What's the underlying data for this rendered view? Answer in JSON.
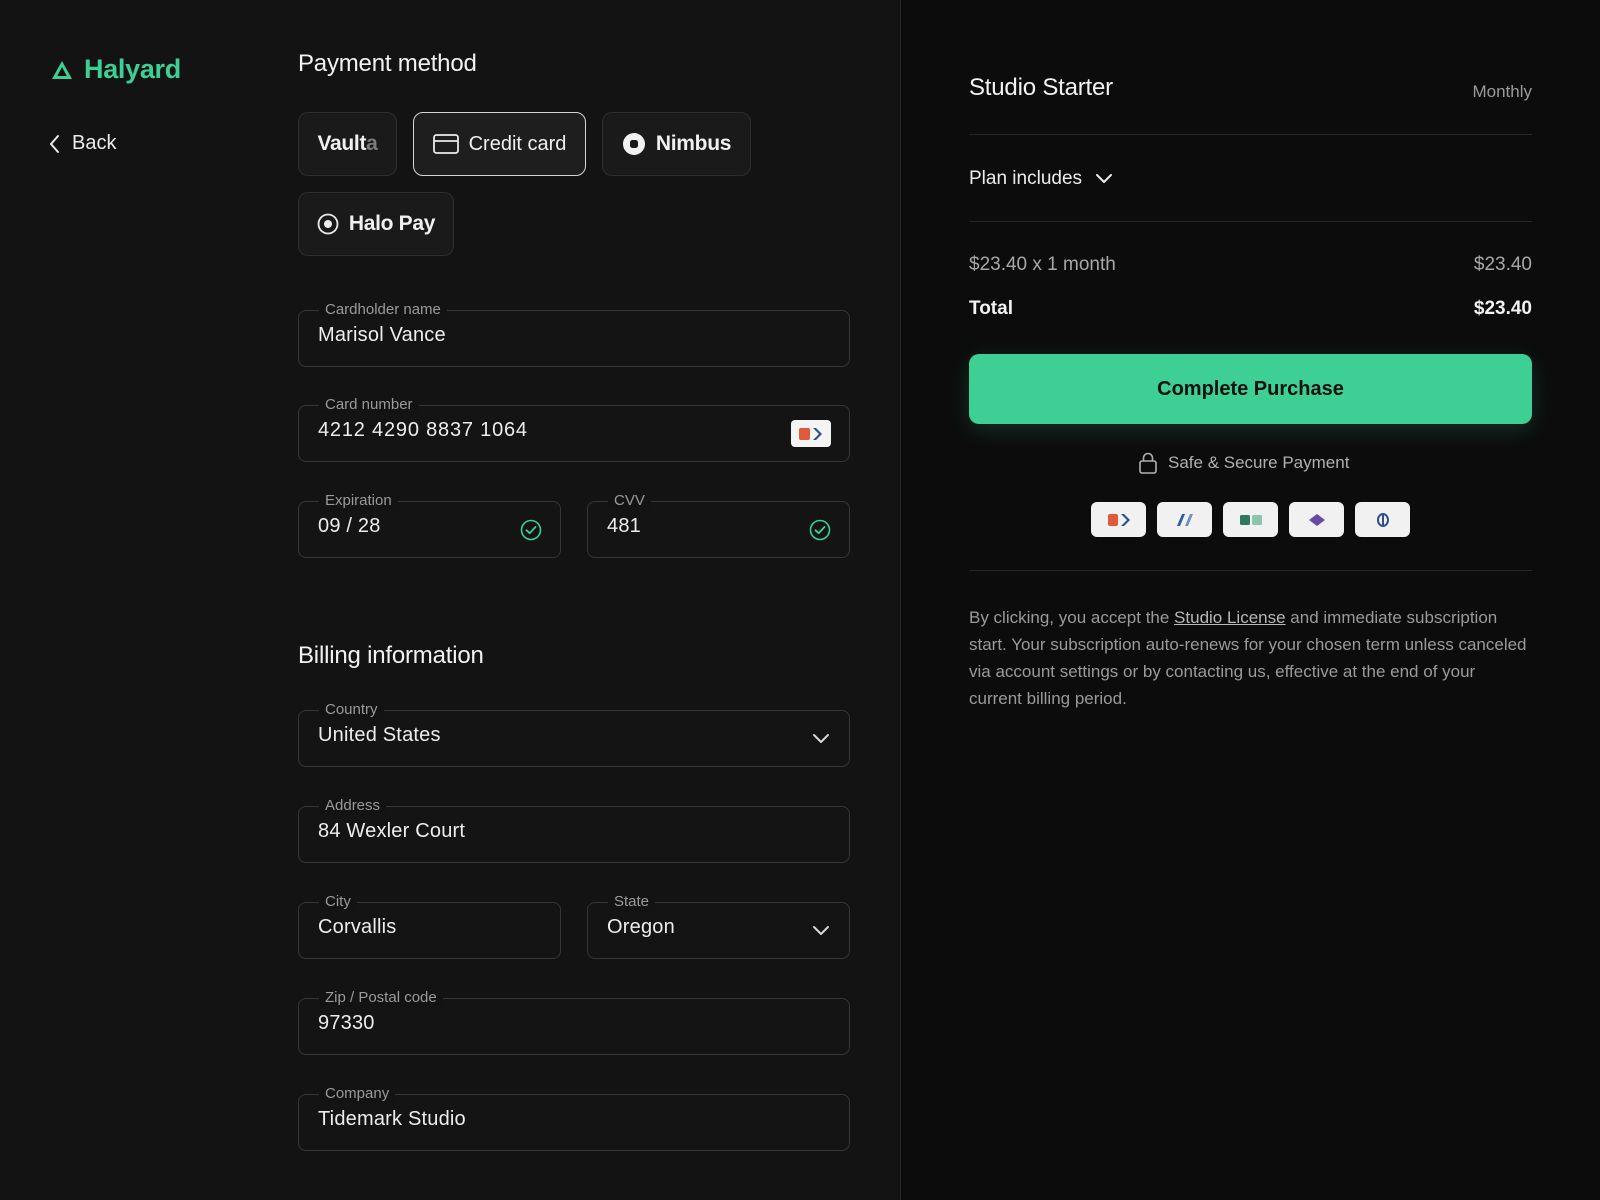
{
  "brand": {
    "name": "Halyard",
    "color": "#3ecf95"
  },
  "nav": {
    "back_label": "Back"
  },
  "payment": {
    "title": "Payment method",
    "options": [
      {
        "id": "vaulta",
        "label_main": "Vault",
        "label_accent": "a",
        "icon": "none",
        "selected": false
      },
      {
        "id": "credit-card",
        "label": "Credit card",
        "icon": "credit-card-icon",
        "selected": true
      },
      {
        "id": "nimbus",
        "label": "Nimbus",
        "icon": "nimbus-logo-icon",
        "selected": false
      },
      {
        "id": "halo-pay",
        "label": "Halo Pay",
        "icon": "halo-pay-logo-icon",
        "selected": false
      }
    ]
  },
  "card": {
    "cardholder": {
      "label": "Cardholder name",
      "value": "Marisol Vance"
    },
    "number": {
      "label": "Card number",
      "value": "4212 4290 8837 1064",
      "brand_icon": "card-brand-icon"
    },
    "expiration": {
      "label": "Expiration",
      "value": "09 / 28",
      "valid": true
    },
    "cvv": {
      "label": "CVV",
      "value": "481",
      "valid": true
    }
  },
  "billing": {
    "title": "Billing information",
    "country": {
      "label": "Country",
      "value": "United States"
    },
    "address": {
      "label": "Address",
      "value": "84 Wexler Court"
    },
    "city": {
      "label": "City",
      "value": "Corvallis"
    },
    "state": {
      "label": "State",
      "value": "Oregon"
    },
    "zip": {
      "label": "Zip / Postal code",
      "value": "97330"
    },
    "company": {
      "label": "Company",
      "value": "Tidemark Studio"
    }
  },
  "summary": {
    "plan_name": "Studio Starter",
    "billing_cycle": "Monthly",
    "plan_includes_label": "Plan includes",
    "line_item_label": "$23.40 x 1 month",
    "line_item_amount": "$23.40",
    "total_label": "Total",
    "total_amount": "$23.40",
    "purchase_label": "Complete Purchase",
    "secure_label": "Safe & Secure Payment",
    "accepted_brands": [
      "card-brand-1-icon",
      "card-brand-2-icon",
      "card-brand-3-icon",
      "card-brand-4-icon",
      "card-brand-5-icon"
    ],
    "legal": {
      "prefix": "By clicking, you accept the ",
      "link": "Studio License",
      "suffix": " and immediate subscription start. Your subscription auto-renews for your chosen term unless canceled via account settings or by contacting us, effective at the end of your current billing period."
    }
  },
  "colors": {
    "accent": "#3ecf95",
    "background": "#131313",
    "panel": "#0c0c0c",
    "valid_check": "#3ecf95"
  }
}
